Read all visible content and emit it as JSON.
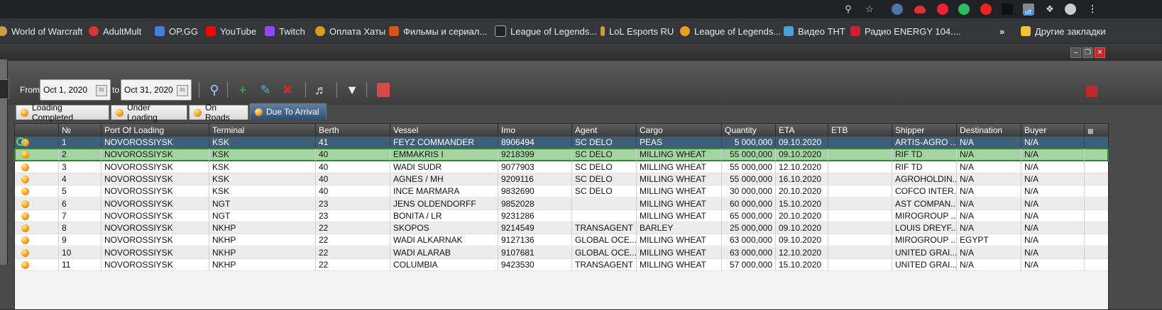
{
  "browser": {
    "top_icons": [
      "zoom-icon",
      "star-icon",
      "vk-icon",
      "cloud-icon",
      "shield-icon",
      "evernote-icon",
      "play-icon",
      "cube-icon",
      "off-badge-icon",
      "puzzle-icon",
      "avatar",
      "kebab-menu-icon"
    ],
    "off_badge": "off"
  },
  "bookmarks": [
    {
      "label": "World of Warcraft",
      "icon": "wow-icon",
      "color": "#c8a040"
    },
    {
      "label": "AdultMult",
      "icon": "adultmult-icon",
      "color": "#d33"
    },
    {
      "label": "OP.GG",
      "icon": "opgg-icon",
      "color": "#4a7ddc"
    },
    {
      "label": "YouTube",
      "icon": "youtube-icon",
      "color": "#f00"
    },
    {
      "label": "Twitch",
      "icon": "twitch-icon",
      "color": "#9146ff"
    },
    {
      "label": "Оплата Хаты",
      "icon": "gear-icon",
      "color": "#d4a020"
    },
    {
      "label": "Фильмы и сериал...",
      "icon": "hd-icon",
      "color": "#e05010"
    },
    {
      "label": "League of Legends...",
      "icon": "pb-icon",
      "color": "#222"
    },
    {
      "label": "LoL Esports RU",
      "icon": "lol-esports-icon",
      "color": "#c89b3c"
    },
    {
      "label": "League of Legends...",
      "icon": "lol-icon",
      "color": "#e8a020"
    },
    {
      "label": "Видео ТНТ",
      "icon": "tnt-icon",
      "color": "#4aa0d8"
    },
    {
      "label": "Радио ENERGY 104....",
      "icon": "radio-icon",
      "color": "#d02030"
    }
  ],
  "bookmarks_more": "»",
  "other_bookmarks": "Другие закладки",
  "toolbar": {
    "from_label": "From",
    "from_value": "Oct 1, 2020",
    "to_label": "to",
    "to_value": "Oct 31, 2020"
  },
  "tabs": [
    {
      "label": "Loading Completed",
      "active": false
    },
    {
      "label": "Under Loading",
      "active": false
    },
    {
      "label": "On Roads",
      "active": false
    },
    {
      "label": "Due To Arrival",
      "active": true
    }
  ],
  "columns": [
    "№",
    "Port Of Loading",
    "Terminal",
    "Berth",
    "Vessel",
    "Imo",
    "Agent",
    "Cargo",
    "Quantity",
    "ETA",
    "ETB",
    "Shipper",
    "Destination",
    "Buyer"
  ],
  "rows": [
    [
      "1",
      "NOVOROSSIYSK",
      "KSK",
      "41",
      "FEYZ COMMANDER",
      "8906494",
      "SC DELO",
      "PEAS",
      "5 000,000",
      "09.10.2020",
      "",
      "ARTIS-AGRO ...",
      "N/A",
      "N/A"
    ],
    [
      "2",
      "NOVOROSSIYSK",
      "KSK",
      "40",
      "EMMAKRIS I",
      "9218399",
      "SC DELO",
      "MILLING WHEAT",
      "55 000,000",
      "09.10.2020",
      "",
      "RIF TD",
      "N/A",
      "N/A"
    ],
    [
      "3",
      "NOVOROSSIYSK",
      "KSK",
      "40",
      "WADI SUDR",
      "9077903",
      "SC DELO",
      "MILLING WHEAT",
      "55 000,000",
      "12.10.2020",
      "",
      "RIF TD",
      "N/A",
      "N/A"
    ],
    [
      "4",
      "NOVOROSSIYSK",
      "KSK",
      "40",
      "AGNES / MH",
      "9209116",
      "SC DELO",
      "MILLING WHEAT",
      "55 000,000",
      "16.10.2020",
      "",
      "AGROHOLDIN...",
      "N/A",
      "N/A"
    ],
    [
      "5",
      "NOVOROSSIYSK",
      "KSK",
      "40",
      "INCE MARMARA",
      "9832690",
      "SC DELO",
      "MILLING WHEAT",
      "30 000,000",
      "20.10.2020",
      "",
      "COFCO INTER...",
      "N/A",
      "N/A"
    ],
    [
      "6",
      "NOVOROSSIYSK",
      "NGT",
      "23",
      "JENS OLDENDORFF",
      "9852028",
      "",
      "MILLING WHEAT",
      "60 000,000",
      "15.10.2020",
      "",
      "AST COMPAN...",
      "N/A",
      "N/A"
    ],
    [
      "7",
      "NOVOROSSIYSK",
      "NGT",
      "23",
      "BONITA / LR",
      "9231286",
      "",
      "MILLING WHEAT",
      "65 000,000",
      "20.10.2020",
      "",
      "MIROGROUP ...",
      "N/A",
      "N/A"
    ],
    [
      "8",
      "NOVOROSSIYSK",
      "NKHP",
      "22",
      "SKOPOS",
      "9214549",
      "TRANSAGENT",
      "BARLEY",
      "25 000,000",
      "09.10.2020",
      "",
      "LOUIS DREYF...",
      "N/A",
      "N/A"
    ],
    [
      "9",
      "NOVOROSSIYSK",
      "NKHP",
      "22",
      "WADI ALKARNAK",
      "9127136",
      "GLOBAL OCE...",
      "MILLING WHEAT",
      "63 000,000",
      "09.10.2020",
      "",
      "MIROGROUP ...",
      "EGYPT",
      "N/A"
    ],
    [
      "10",
      "NOVOROSSIYSK",
      "NKHP",
      "22",
      "WADI ALARAB",
      "9107681",
      "GLOBAL OCE...",
      "MILLING WHEAT",
      "63 000,000",
      "12.10.2020",
      "",
      "UNITED GRAI...",
      "N/A",
      "N/A"
    ],
    [
      "11",
      "NOVOROSSIYSK",
      "NKHP",
      "22",
      "COLUMBIA",
      "9423530",
      "TRANSAGENT",
      "MILLING WHEAT",
      "57 000,000",
      "15.10.2020",
      "",
      "UNITED GRAI...",
      "N/A",
      "N/A"
    ]
  ],
  "selected_row": 0,
  "highlighted_row": 1
}
